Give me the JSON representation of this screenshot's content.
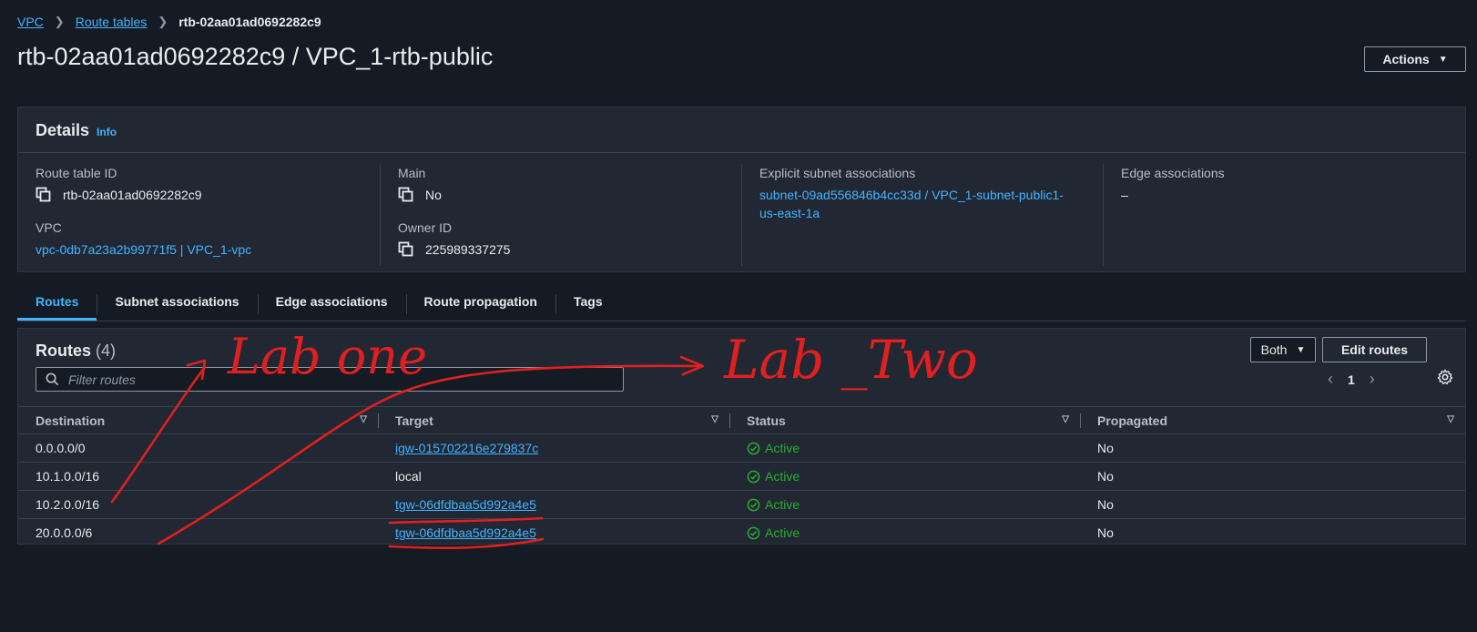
{
  "breadcrumb": {
    "items": [
      "VPC",
      "Route tables"
    ],
    "current": "rtb-02aa01ad0692282c9"
  },
  "page": {
    "title": "rtb-02aa01ad0692282c9 / VPC_1-rtb-public",
    "actions_label": "Actions"
  },
  "details": {
    "title": "Details",
    "info_label": "Info",
    "route_table_id_label": "Route table ID",
    "route_table_id": "rtb-02aa01ad0692282c9",
    "vpc_label": "VPC",
    "vpc": "vpc-0db7a23a2b99771f5 | VPC_1-vpc",
    "main_label": "Main",
    "main": "No",
    "owner_id_label": "Owner ID",
    "owner_id": "225989337275",
    "explicit_label": "Explicit subnet associations",
    "explicit_line1": "subnet-09ad556846b4cc33d / VPC_1-subnet-public1-",
    "explicit_line2": "us-east-1a",
    "edge_label": "Edge associations",
    "edge": "–"
  },
  "tabs": [
    "Routes",
    "Subnet associations",
    "Edge associations",
    "Route propagation",
    "Tags"
  ],
  "routes": {
    "title": "Routes",
    "count": "(4)",
    "filter_placeholder": "Filter routes",
    "both_label": "Both",
    "edit_label": "Edit routes",
    "page_number": "1",
    "columns": [
      "Destination",
      "Target",
      "Status",
      "Propagated"
    ],
    "rows": [
      {
        "destination": "0.0.0.0/0",
        "target": "igw-015702216e279837c",
        "status": "Active",
        "propagated": "No"
      },
      {
        "destination": "10.1.0.0/16",
        "target": "local",
        "status": "Active",
        "propagated": "No"
      },
      {
        "destination": "10.2.0.0/16",
        "target": "tgw-06dfdbaa5d992a4e5",
        "status": "Active",
        "propagated": "No"
      },
      {
        "destination": "20.0.0.0/6",
        "target": "tgw-06dfdbaa5d992a4e5",
        "status": "Active",
        "propagated": "No"
      }
    ]
  },
  "annotations": {
    "label_one": "Lab one",
    "label_two": "Lab _Two",
    "ink_color": "#e0201f"
  },
  "colors": {
    "accent": "#42b4ff",
    "success": "#29ad32",
    "background": "#151b24",
    "panel": "#212733"
  }
}
